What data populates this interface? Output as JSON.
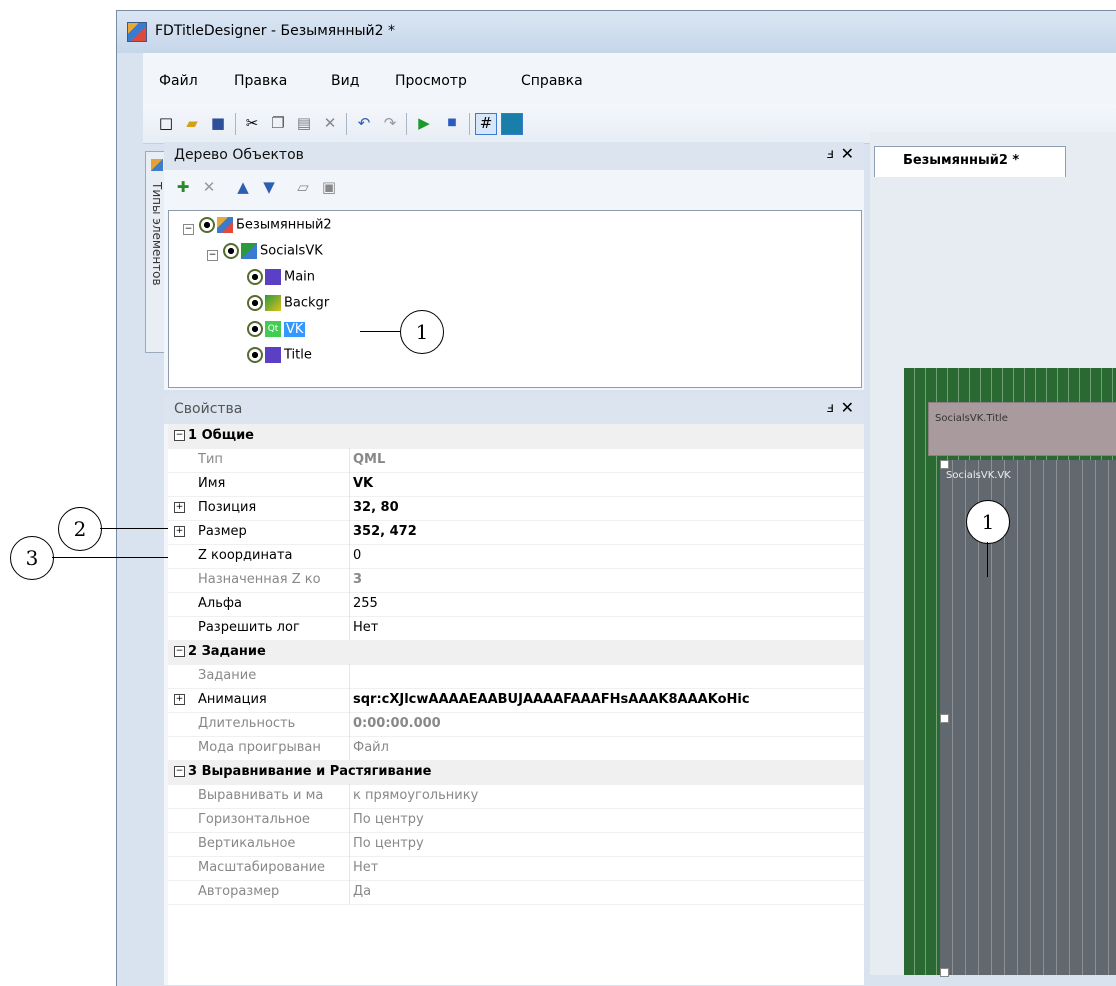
{
  "window": {
    "title": "FDTitleDesigner - Безымянный2 *"
  },
  "menu": [
    "Файл",
    "Правка",
    "Вид",
    "Просмотр",
    "Справка"
  ],
  "toolbar": {
    "icons": [
      "new-icon",
      "open-icon",
      "save-icon",
      "cut-icon",
      "copy-icon",
      "paste-icon",
      "delete-icon",
      "undo-icon",
      "redo-icon",
      "play-icon",
      "stop-icon",
      "grid-icon",
      "frame-icon"
    ]
  },
  "sidebar_tab": {
    "label": "Типы элементов"
  },
  "tree_panel": {
    "title": "Дерево Объектов",
    "pin": "ㅁ",
    "close": "✕",
    "nodes": [
      {
        "label": "Безымянный2"
      },
      {
        "label": "SocialsVK"
      },
      {
        "label": "Main"
      },
      {
        "label": "Backgr"
      },
      {
        "label": "VK"
      },
      {
        "label": "Title"
      }
    ]
  },
  "props_panel": {
    "title": "Свойства",
    "rows": [
      {
        "key": "1 Общие",
        "value": ""
      },
      {
        "key": "Тип",
        "value": "QML"
      },
      {
        "key": "Имя",
        "value": "VK"
      },
      {
        "key": "Позиция",
        "value": "32, 80"
      },
      {
        "key": "Размер",
        "value": "352, 472"
      },
      {
        "key": "Z координата",
        "value": "0"
      },
      {
        "key": "Назначенная Z ко",
        "value": "3"
      },
      {
        "key": "Альфа",
        "value": "255"
      },
      {
        "key": "Разрешить лог",
        "value": "Нет"
      },
      {
        "key": "2 Задание",
        "value": ""
      },
      {
        "key": "Задание",
        "value": ""
      },
      {
        "key": "Анимация",
        "value": "sqr:cXJlcwAAAAEAABUJAAAAFAAAFHsAAAK8AAAKoHic"
      },
      {
        "key": "Длительность",
        "value": "0:00:00.000"
      },
      {
        "key": "Мода проигрыван",
        "value": "Файл"
      },
      {
        "key": "3 Выравнивание и Растягивание",
        "value": ""
      },
      {
        "key": "Выравнивать и ма",
        "value": "к прямоугольнику"
      },
      {
        "key": "Горизонтальное",
        "value": "По центру"
      },
      {
        "key": "Вертикальное",
        "value": "По центру"
      },
      {
        "key": "Масштабирование",
        "value": "Нет"
      },
      {
        "key": "Авторазмер",
        "value": "Да"
      }
    ]
  },
  "doc": {
    "tab": "Безымянный2 *",
    "canvas_labels": {
      "title_rect": "SocialsVK.Title",
      "vk_rect": "SocialsVK.VK"
    }
  },
  "callouts": [
    "1",
    "2",
    "3",
    "1"
  ]
}
